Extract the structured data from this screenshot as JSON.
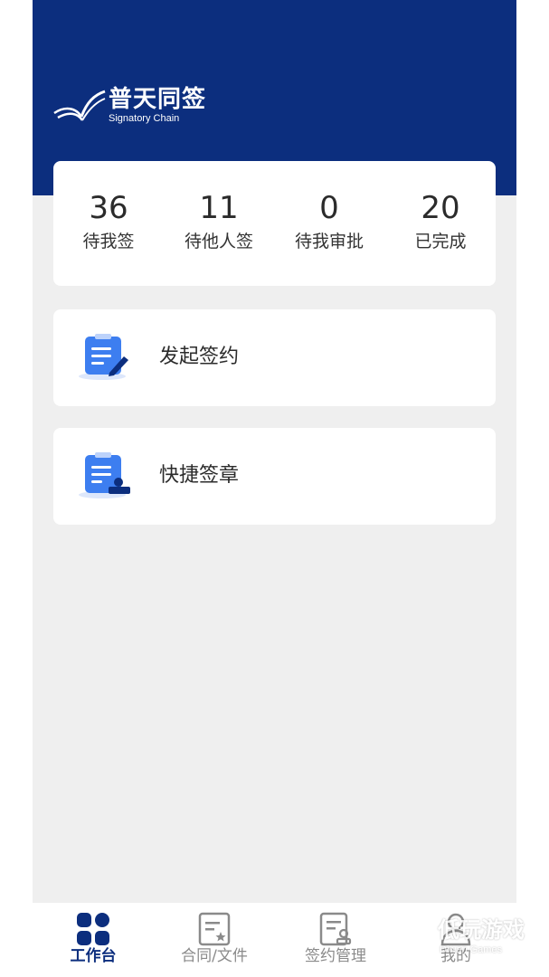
{
  "brand": {
    "title": "普天同签",
    "subtitle": "Signatory Chain",
    "header_color": "#0c2e7e"
  },
  "stats": [
    {
      "value": "36",
      "label": "待我签"
    },
    {
      "value": "11",
      "label": "待他人签"
    },
    {
      "value": "0",
      "label": "待我审批"
    },
    {
      "value": "20",
      "label": "已完成"
    }
  ],
  "actions": [
    {
      "label": "发起签约",
      "icon": "document-pen-icon"
    },
    {
      "label": "快捷签章",
      "icon": "document-stamp-icon"
    }
  ],
  "tabbar": {
    "items": [
      {
        "label": "工作台",
        "icon": "grid-icon",
        "active": true
      },
      {
        "label": "合同/文件",
        "icon": "contract-star-icon",
        "active": false
      },
      {
        "label": "签约管理",
        "icon": "sign-manage-icon",
        "active": false
      },
      {
        "label": "我的",
        "icon": "user-icon",
        "active": false
      }
    ],
    "active_color": "#0c2e7e",
    "inactive_color": "#8a8a8a"
  },
  "watermark": {
    "text": "低玩游戏",
    "subtext": "Diwan Games"
  }
}
